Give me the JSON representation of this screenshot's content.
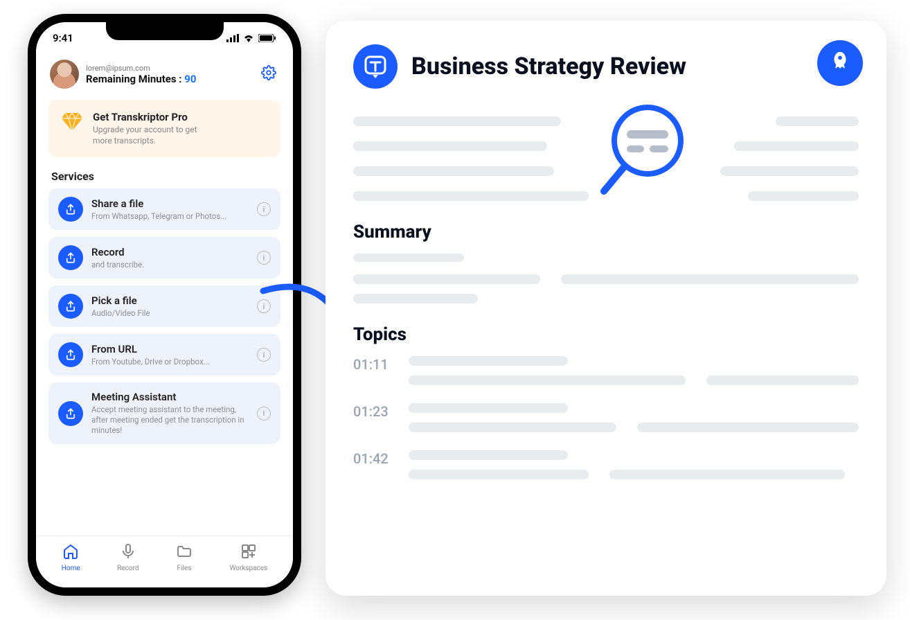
{
  "phone": {
    "status_time": "9:41",
    "user_email": "lorem@ipsum.com",
    "minutes_label": "Remaining Minutes : ",
    "minutes_value": "90",
    "promo": {
      "title": "Get Transkriptor Pro",
      "subtitle": "Upgrade your account to get more transcripts."
    },
    "services_heading": "Services",
    "services": [
      {
        "title": "Share a file",
        "subtitle": "From Whatsapp, Telegram or Photos..."
      },
      {
        "title": "Record",
        "subtitle": "and transcribe."
      },
      {
        "title": "Pick a file",
        "subtitle": "Audio/Video File"
      },
      {
        "title": "From URL",
        "subtitle": "From Youtube, Drive or Dropbox..."
      },
      {
        "title": "Meeting Assistant",
        "subtitle": "Accept meeting assistant to the meeting, after meeting ended get the transcription in minutes!"
      }
    ],
    "tabs": [
      {
        "label": "Home"
      },
      {
        "label": "Record"
      },
      {
        "label": "Files"
      },
      {
        "label": "Workspaces"
      }
    ]
  },
  "document": {
    "title": "Business Strategy Review",
    "summary_heading": "Summary",
    "topics_heading": "Topics",
    "topics": [
      {
        "time": "01:11"
      },
      {
        "time": "01:23"
      },
      {
        "time": "01:42"
      }
    ]
  },
  "colors": {
    "primary": "#1a5cff",
    "muted_bg": "#eef3fb",
    "promo_bg": "#fff5ea"
  }
}
